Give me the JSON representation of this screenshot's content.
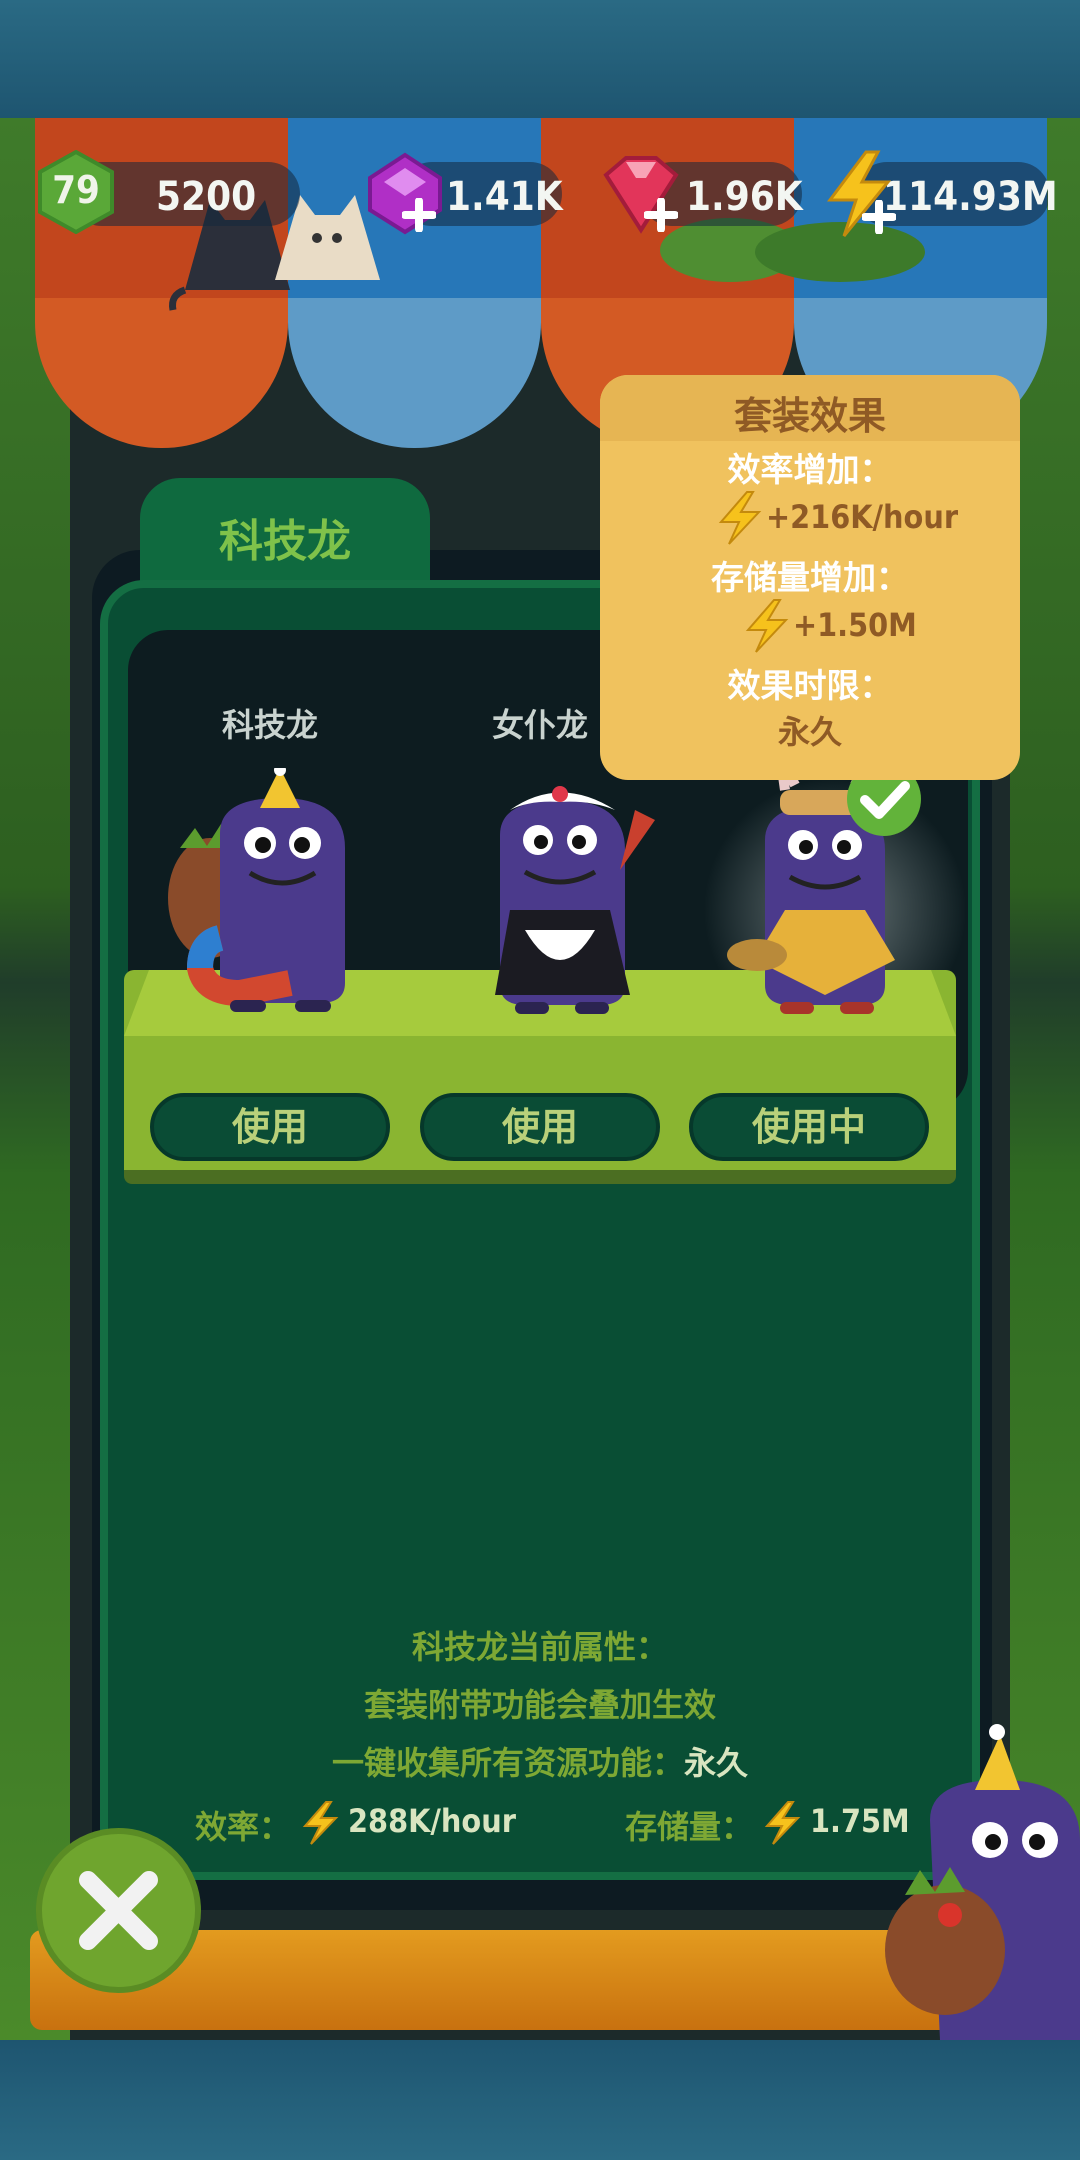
{
  "resources": {
    "level": "79",
    "coins": "5200",
    "purple_gems": "1.41K",
    "red_gems": "1.96K",
    "energy": "114.93M"
  },
  "tab": {
    "label": "科技龙"
  },
  "characters": [
    {
      "name": "科技龙",
      "button": "使用",
      "state": "available"
    },
    {
      "name": "女仆龙",
      "button": "使用",
      "state": "available"
    },
    {
      "name": "",
      "button": "使用中",
      "state": "in-use"
    }
  ],
  "tooltip": {
    "title": "套装效果",
    "efficiency_label": "效率增加：",
    "efficiency_value": "+216K/hour",
    "storage_label": "存储量增加：",
    "storage_value": "+1.50M",
    "duration_label": "效果时限：",
    "duration_value": "永久"
  },
  "info": {
    "line1": "科技龙当前属性：",
    "line2": "套装附带功能会叠加生效",
    "line3_label": "一键收集所有资源功能：",
    "line3_value": "永久",
    "efficiency_label": "效率：",
    "efficiency_value": "288K/hour",
    "storage_label": "存储量：",
    "storage_value": "1.75M"
  },
  "colors": {
    "panel": "#094e34",
    "accent_green": "#7ea834",
    "tooltip": "#f0c25e",
    "awning_red": "#c2461d",
    "awning_blue": "#2777b8"
  },
  "icons": [
    "level-hex-icon",
    "purple-gem-icon",
    "red-gem-icon",
    "lightning-icon",
    "checkmark-icon",
    "close-icon",
    "plus-icon"
  ]
}
